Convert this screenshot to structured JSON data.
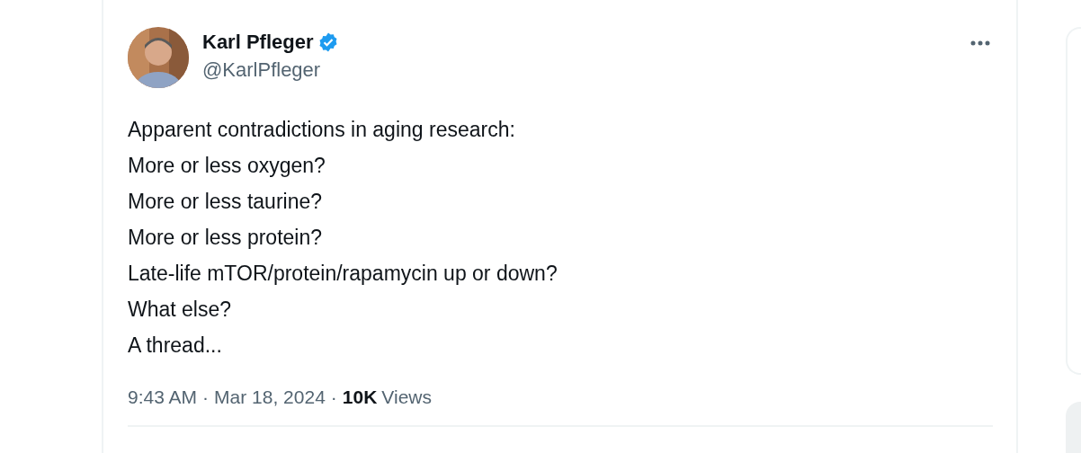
{
  "tweet": {
    "author": {
      "name": "Karl Pfleger",
      "verified": true,
      "handle": "@KarlPfleger"
    },
    "lines": [
      "Apparent contradictions in aging research:",
      "More or less oxygen?",
      "More or less taurine?",
      "More or less protein?",
      "Late-life mTOR/protein/rapamycin up or down?",
      "What else?",
      "A thread..."
    ],
    "meta": {
      "time": "9:43 AM",
      "separator": "·",
      "date": "Mar 18, 2024",
      "views_count": "10K",
      "views_label": "Views"
    }
  }
}
